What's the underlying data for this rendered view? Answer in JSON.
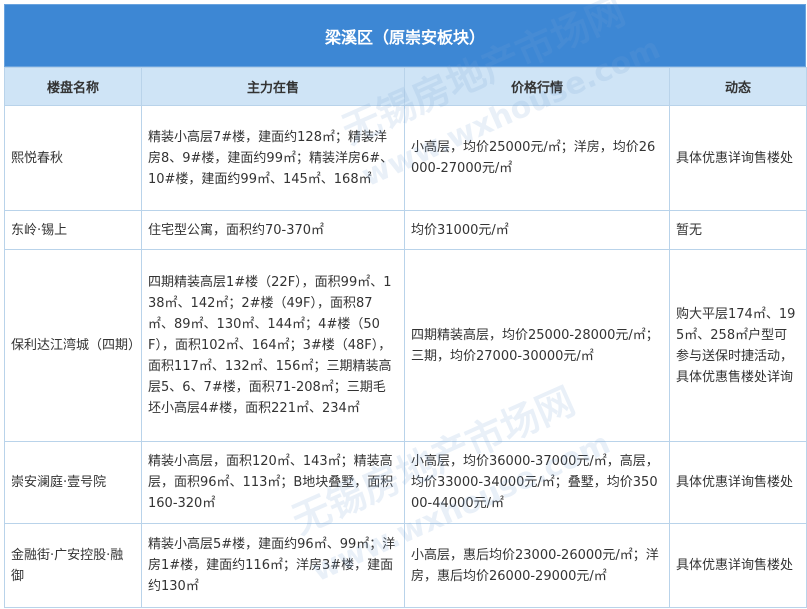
{
  "title": "梁溪区（原崇安板块）",
  "headers": [
    "楼盘名称",
    "主力在售",
    "价格行情",
    "动态"
  ],
  "rows": [
    {
      "name": "熙悦春秋",
      "supply": "精装小高层7#楼，建面约128㎡；精装洋房8、9#楼，建面约99㎡；精装洋房6#、10#楼，建面约99㎡、145㎡、168㎡",
      "price": "小高层，均价25000元/㎡；洋房，均价26000-27000元/㎡",
      "news": "具体优惠详询售楼处"
    },
    {
      "name": "东岭·锡上",
      "supply": "住宅型公寓，面积约70-370㎡",
      "price": "均价31000元/㎡",
      "news": "暂无"
    },
    {
      "name": "保利达江湾城（四期）",
      "supply": "四期精装高层1#楼（22F），面积99㎡、138㎡、142㎡；2#楼（49F），面积87㎡、89㎡、130㎡、144㎡；4#楼（50F），面积102㎡、164㎡；3#楼（48F），面积117㎡、132㎡、156㎡；三期精装高层5、6、7#楼，面积71-208㎡；三期毛坯小高层4#楼，面积221㎡、234㎡",
      "price": "四期精装高层，均价25000-28000元/㎡；三期，均价27000-30000元/㎡",
      "news": "购大平层174㎡、195㎡、258㎡户型可参与送保时捷活动，具体优惠售楼处详询"
    },
    {
      "name": "崇安澜庭·壹号院",
      "supply": "精装小高层，面积120㎡、143㎡；精装高层，面积96㎡、113㎡；B地块叠墅，面积160-320㎡",
      "price": "小高层，均价36000-37000元/㎡，高层，均价33000-34000元/㎡；叠墅，均价35000-44000元/㎡",
      "news": "具体优惠详询售楼处"
    },
    {
      "name": "金融街·广安控股·融御",
      "supply": "精装小高层5#楼，建面约96㎡、99㎡；洋房1#楼，建面约116㎡；洋房3#楼，建面约130㎡",
      "price": "小高层，惠后均价23000-26000元/㎡；洋房，惠后均价26000-29000元/㎡",
      "news": "具体优惠详询售楼处"
    }
  ],
  "watermark": {
    "cn": "无锡房地产市场网",
    "en": "www.wxhouse.com"
  }
}
